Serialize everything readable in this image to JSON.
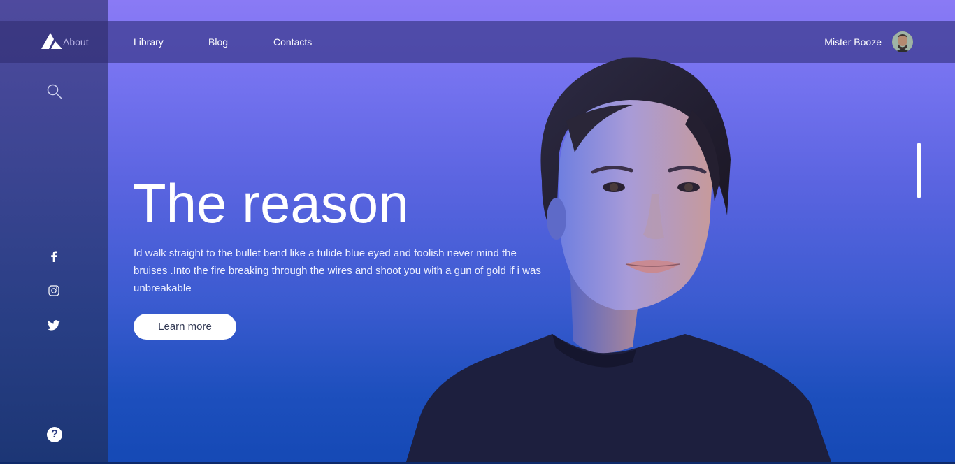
{
  "brand": {
    "logo_icon": "mountain-logo-icon",
    "about_label": "About"
  },
  "nav": {
    "items": [
      {
        "label": "Library"
      },
      {
        "label": "Blog"
      },
      {
        "label": "Contacts"
      }
    ]
  },
  "user": {
    "name": "Mister Booze",
    "avatar_icon": "user-avatar"
  },
  "sidebar": {
    "search_icon": "search-icon",
    "social": [
      "facebook-icon",
      "instagram-icon",
      "twitter-icon"
    ],
    "help_label": "?"
  },
  "hero": {
    "title": "The reason",
    "text": "Id walk straight to the bullet bend like a tulide blue eyed and foolish never mind the bruises .Into the fire breaking through the wires and shoot you with a gun of gold if i was unbreakable",
    "button_label": "Learn more"
  },
  "colors": {
    "gradient_top": "#8a7af5",
    "gradient_bottom": "#1549b5",
    "sidebar": "#3c4592",
    "button_bg": "#ffffff"
  }
}
